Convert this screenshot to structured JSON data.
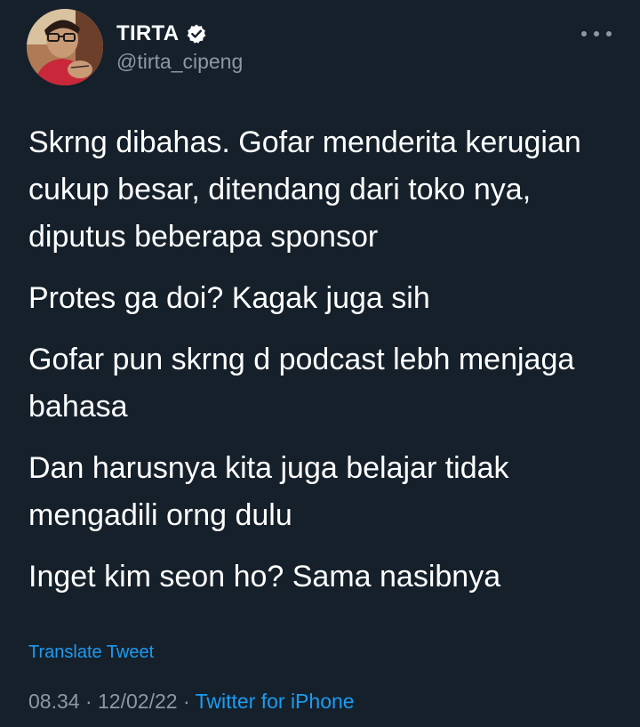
{
  "author": {
    "display_name": "TIRTA",
    "handle": "@tirta_cipeng",
    "verified_icon": "verified-badge-icon"
  },
  "more_icon": "more-horizontal-icon",
  "tweet": {
    "paragraphs": [
      "Skrng dibahas. Gofar menderita kerugian cukup besar, ditendang dari toko nya, diputus beberapa sponsor",
      "Protes ga doi? Kagak juga sih",
      "Gofar pun skrng d podcast lebh menjaga bahasa",
      "Dan harusnya kita juga belajar tidak mengadili orng dulu",
      "Inget kim seon ho? Sama nasibnya"
    ],
    "translate_label": "Translate Tweet"
  },
  "meta": {
    "time": "08.34",
    "date": "12/02/22",
    "separator": "·",
    "source": "Twitter for iPhone"
  },
  "colors": {
    "background": "#15202b",
    "text": "#ffffff",
    "secondary": "#8b98a5",
    "accent": "#1d9bf0"
  }
}
